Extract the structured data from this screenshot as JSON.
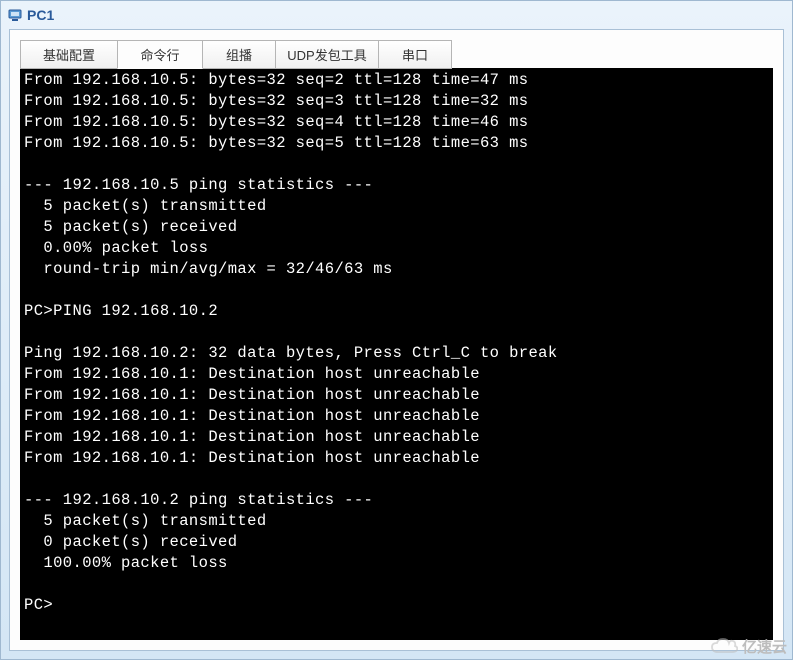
{
  "window": {
    "title": "PC1"
  },
  "tabs": [
    {
      "label": "基础配置"
    },
    {
      "label": "命令行"
    },
    {
      "label": "组播"
    },
    {
      "label": "UDP发包工具"
    },
    {
      "label": "串口"
    }
  ],
  "terminal": {
    "lines": [
      "From 192.168.10.5: bytes=32 seq=2 ttl=128 time=47 ms",
      "From 192.168.10.5: bytes=32 seq=3 ttl=128 time=32 ms",
      "From 192.168.10.5: bytes=32 seq=4 ttl=128 time=46 ms",
      "From 192.168.10.5: bytes=32 seq=5 ttl=128 time=63 ms",
      "",
      "--- 192.168.10.5 ping statistics ---",
      "  5 packet(s) transmitted",
      "  5 packet(s) received",
      "  0.00% packet loss",
      "  round-trip min/avg/max = 32/46/63 ms",
      "",
      "PC>PING 192.168.10.2",
      "",
      "Ping 192.168.10.2: 32 data bytes, Press Ctrl_C to break",
      "From 192.168.10.1: Destination host unreachable",
      "From 192.168.10.1: Destination host unreachable",
      "From 192.168.10.1: Destination host unreachable",
      "From 192.168.10.1: Destination host unreachable",
      "From 192.168.10.1: Destination host unreachable",
      "",
      "--- 192.168.10.2 ping statistics ---",
      "  5 packet(s) transmitted",
      "  0 packet(s) received",
      "  100.00% packet loss",
      "",
      "PC>"
    ]
  },
  "watermark": {
    "text": "亿速云"
  }
}
